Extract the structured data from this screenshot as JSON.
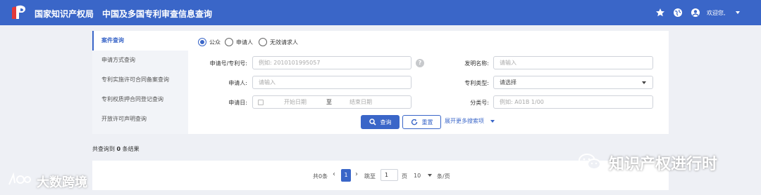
{
  "header": {
    "brand": "国家知识产权局",
    "system_title": "中国及多国专利审查信息查询",
    "welcome": "欢迎您,",
    "icons": [
      "star-icon",
      "globe-icon",
      "user-icon",
      "chevron-down-icon"
    ]
  },
  "sidebar": {
    "items": [
      {
        "label": "案件查询",
        "active": true
      },
      {
        "label": "申请方式查询"
      },
      {
        "label": "专利实施许可合同备案查询"
      },
      {
        "label": "专利权质押合同登记查询"
      },
      {
        "label": "开放许可声明查询"
      }
    ]
  },
  "form": {
    "radios": [
      {
        "label": "公众",
        "checked": true
      },
      {
        "label": "申请人"
      },
      {
        "label": "无效请求人"
      }
    ],
    "app_no_label": "申请号/专利号:",
    "app_no_placeholder": "例如: 2010101995057",
    "invention_name_label": "发明名称:",
    "invention_name_placeholder": "请输入",
    "applicant_label": "申请人:",
    "applicant_placeholder": "请输入",
    "patent_type_label": "专利类型:",
    "patent_type_placeholder": "请选择",
    "app_date_label": "申请日:",
    "start_date_placeholder": "开始日期",
    "date_sep": "至",
    "end_date_placeholder": "结束日期",
    "class_label": "分类号:",
    "class_placeholder": "例如: A01B 1/00",
    "help": "?",
    "search_label": "查询",
    "reset_label": "重置",
    "expand_label": "展开更多搜索项"
  },
  "results": {
    "prefix": "共查询到",
    "count": "0",
    "suffix": "条结果"
  },
  "pagination": {
    "total": "共0条",
    "current_page": "1",
    "goto_label": "跳至",
    "goto_value": "1",
    "page_unit": "页",
    "page_size": "10",
    "per_page": "条/页"
  },
  "watermarks": {
    "left": "大数跨境",
    "right": "知识产权进行时"
  },
  "colors": {
    "primary": "#3a66c8",
    "page_bg": "#eef0f5"
  }
}
